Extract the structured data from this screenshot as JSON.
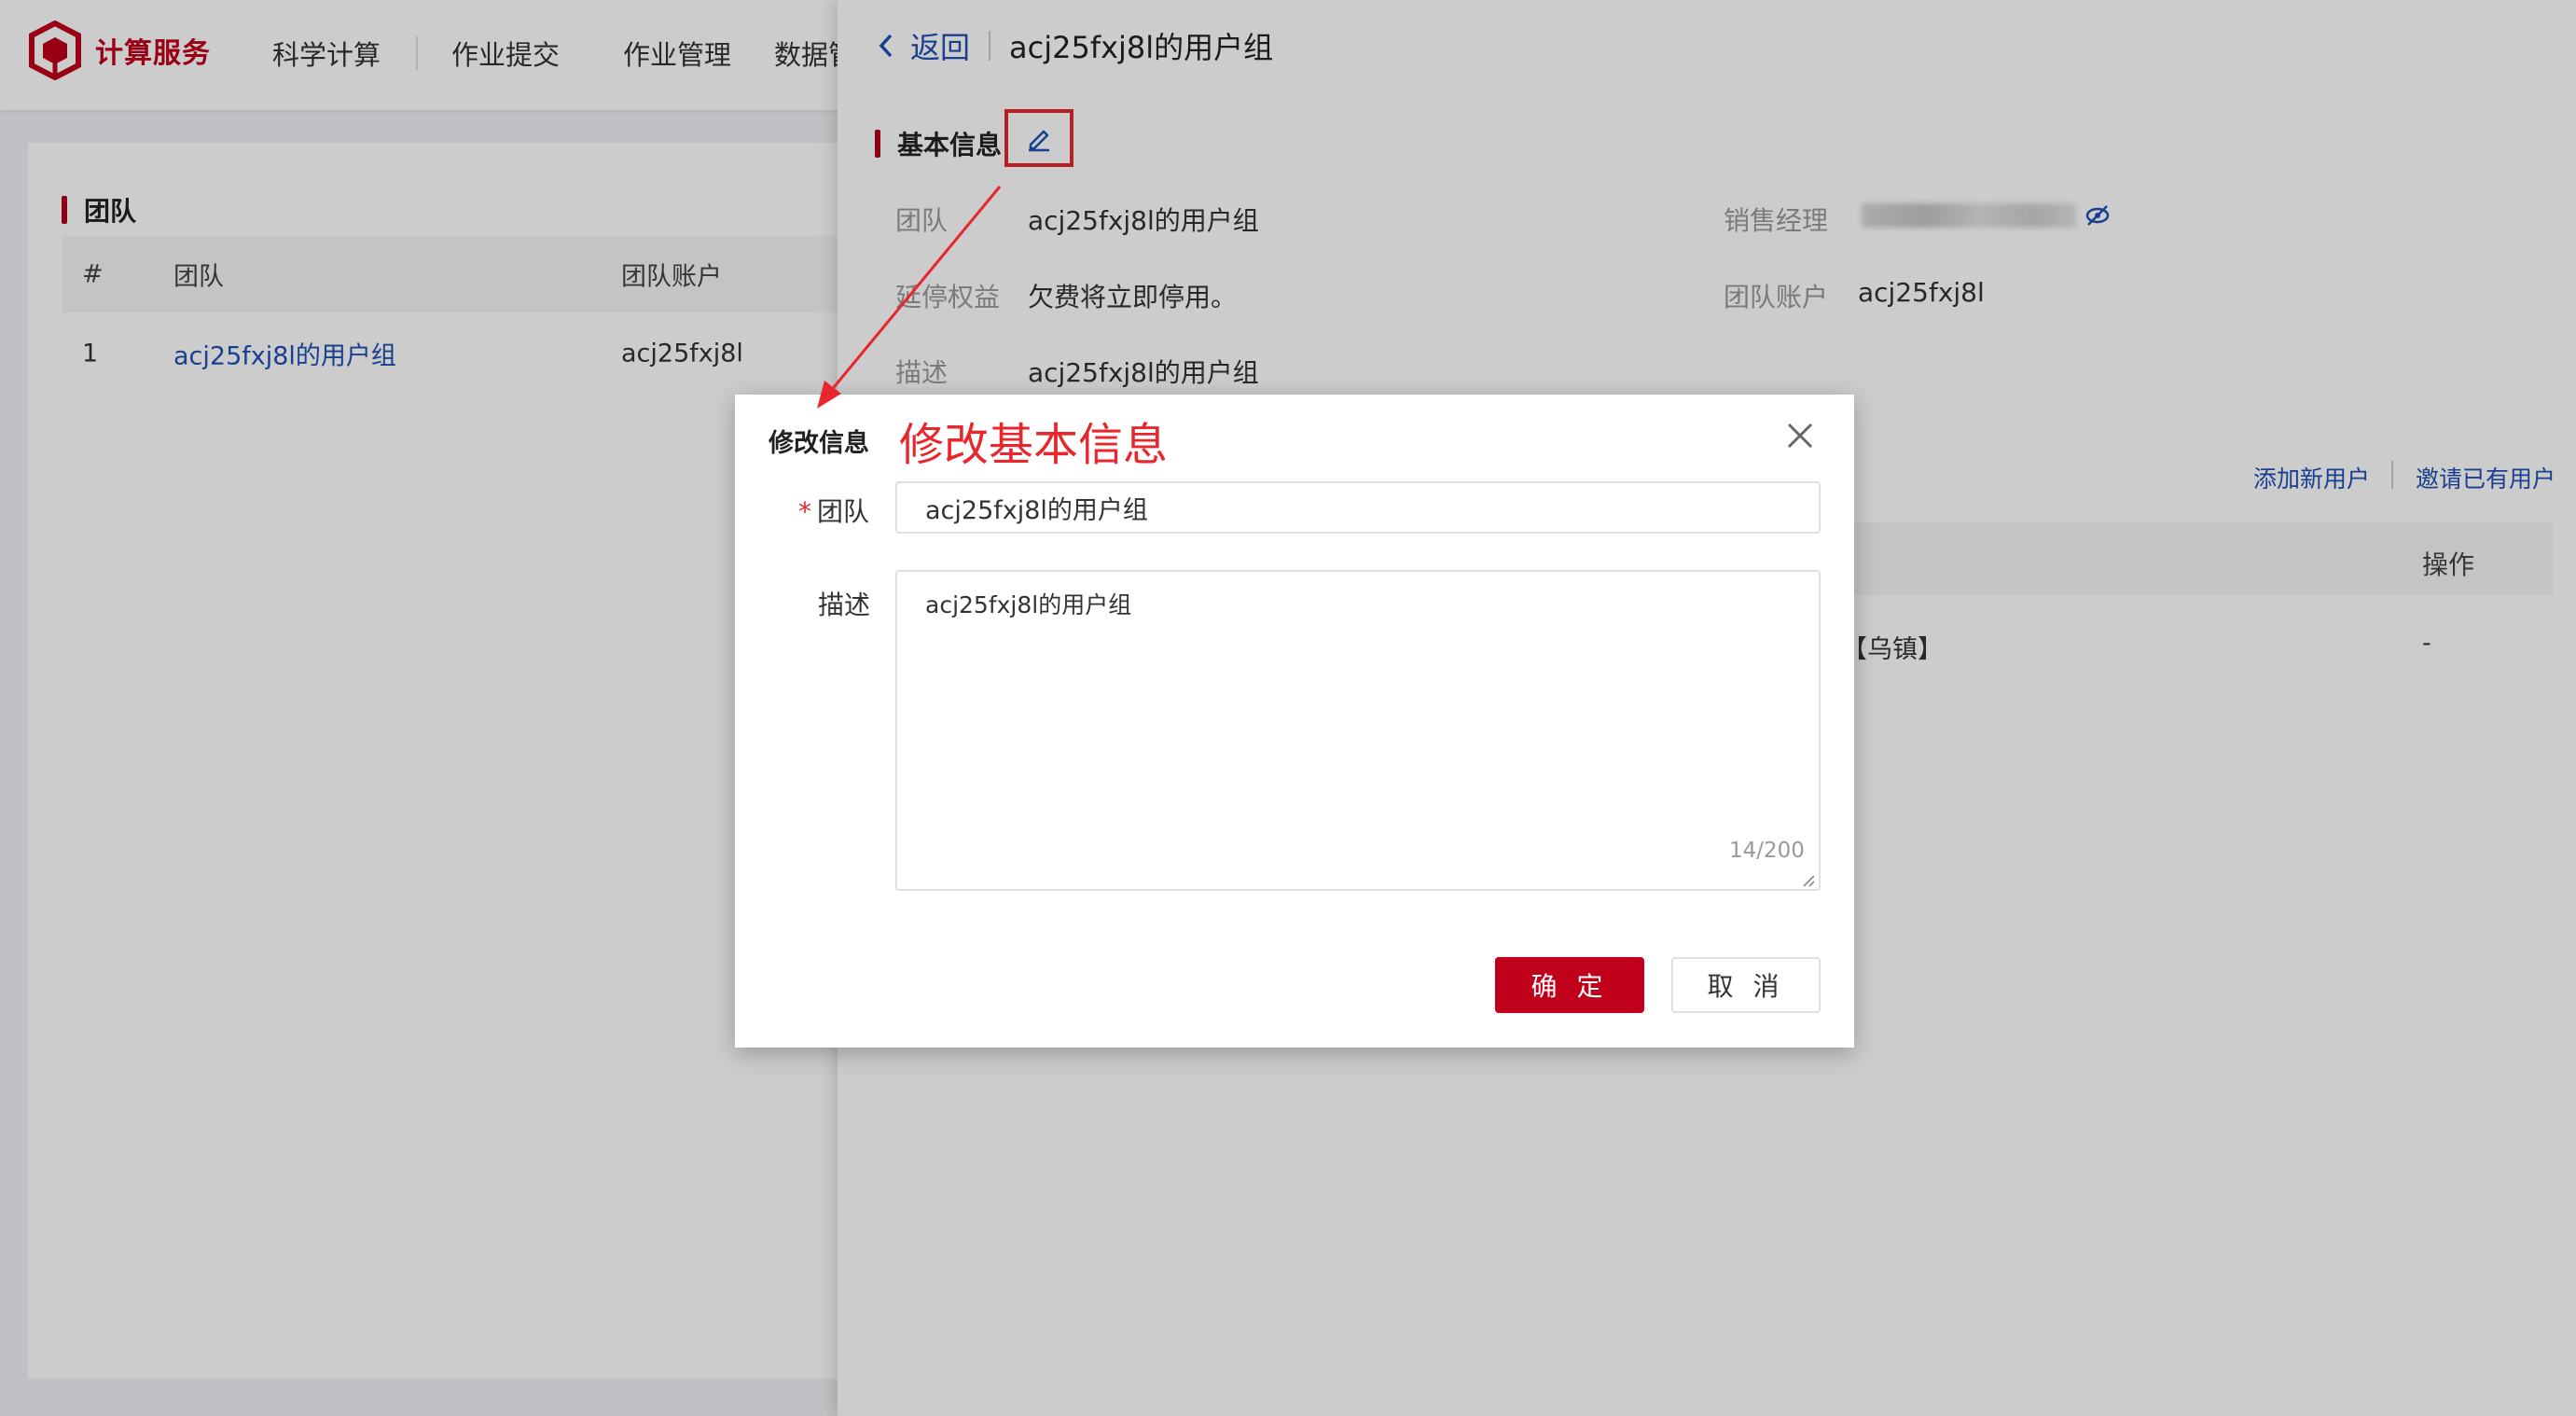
{
  "app": {
    "brand": "计算服务",
    "brand_color": "#c0001a",
    "nav": [
      "科学计算",
      "作业提交",
      "作业管理",
      "数据管"
    ]
  },
  "team_panel": {
    "title": "团队",
    "columns": [
      "#",
      "团队",
      "团队账户"
    ],
    "rows": [
      {
        "index": "1",
        "team": "acj25fxj8l的用户组",
        "account": "acj25fxj8l"
      }
    ]
  },
  "drawer": {
    "back_label": "返回",
    "title": "acj25fxj8l的用户组",
    "basic_info_title": "基本信息",
    "info": {
      "team_label": "团队",
      "team_value": "acj25fxj8l的用户组",
      "sales_label": "销售经理",
      "delay_label": "延停权益",
      "delay_value": "欠费将立即停用。",
      "account_label": "团队账户",
      "account_value": "acj25fxj8l",
      "desc_label": "描述",
      "desc_value": "acj25fxj8l的用户组"
    },
    "actions": {
      "add_user": "添加新用户",
      "invite_user": "邀请已有用户"
    },
    "users_table": {
      "op_header": "操作",
      "row_text": "【乌镇】",
      "row_op": "-"
    }
  },
  "modal": {
    "title": "修改信息",
    "annotation": "修改基本信息",
    "annotation_color": "#e8262c",
    "required_mark": "*",
    "team_label": "团队",
    "team_value": "acj25fxj8l的用户组",
    "desc_label": "描述",
    "desc_value": "acj25fxj8l的用户组",
    "counter": "14/200",
    "confirm": "确 定",
    "cancel": "取 消"
  }
}
